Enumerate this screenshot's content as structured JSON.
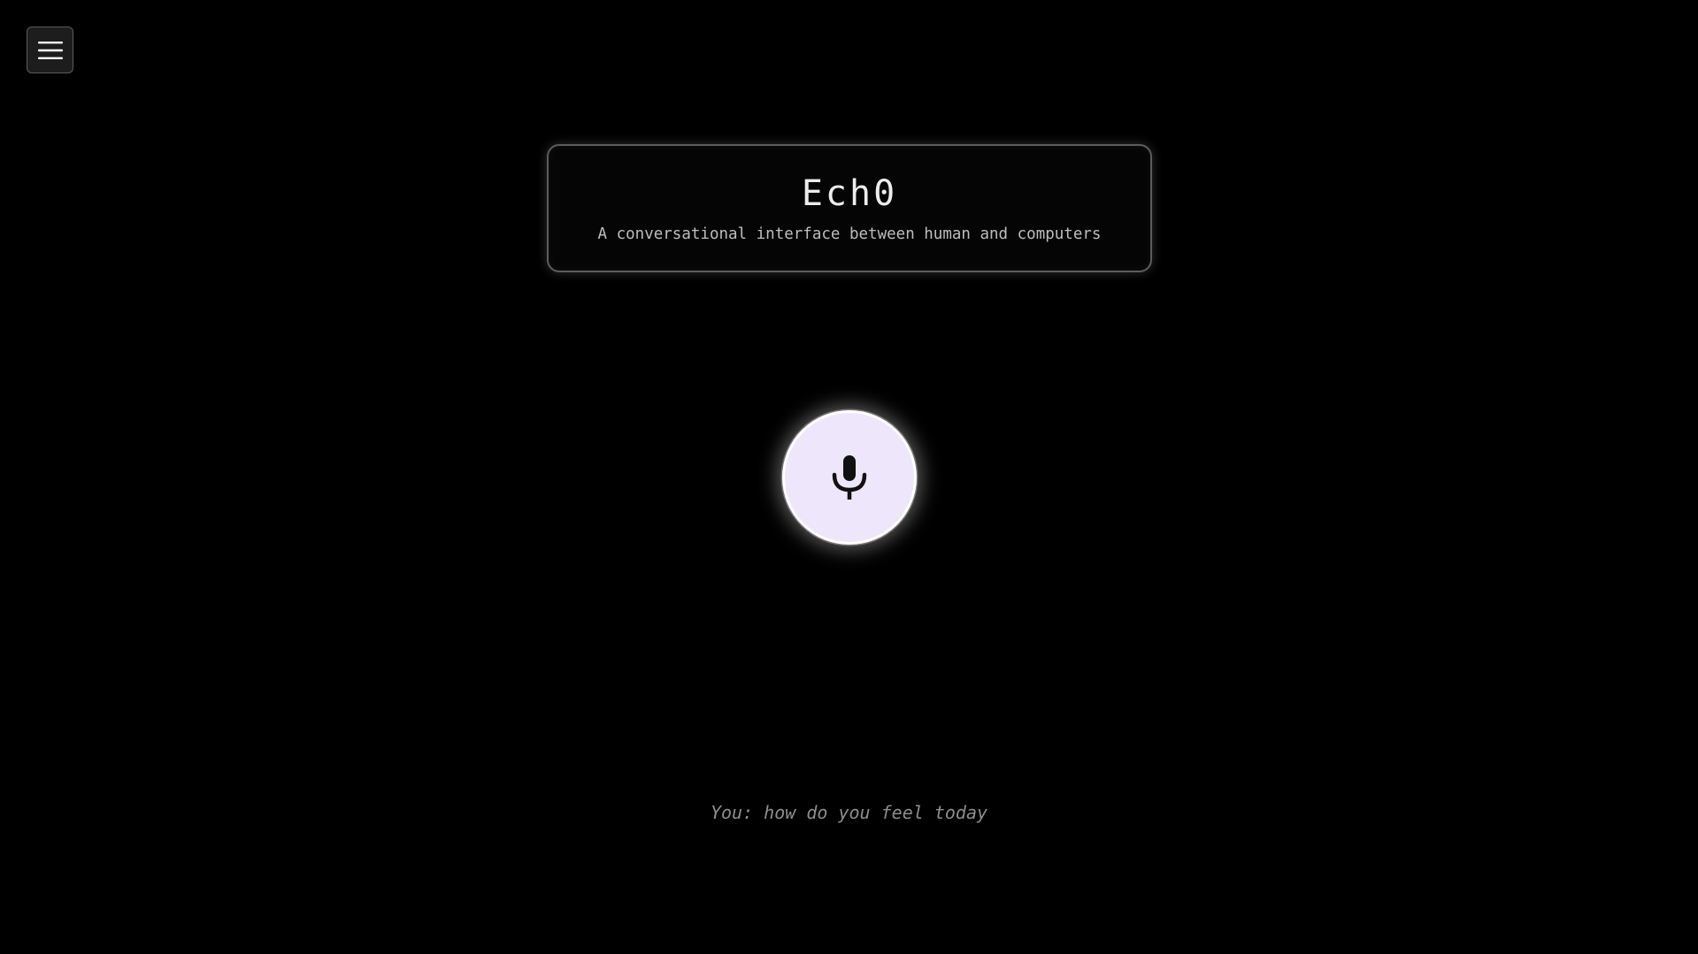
{
  "menu": {
    "icon": "hamburger-menu-icon"
  },
  "header": {
    "title": "Ech0",
    "subtitle": "A conversational interface between human and computers"
  },
  "mic": {
    "icon": "microphone-icon"
  },
  "transcript": {
    "text": "You: how do you feel today"
  },
  "colors": {
    "background": "#000000",
    "mic_fill": "#eee6fb",
    "card_border": "#5c5c5c",
    "transcript_text": "#8d8d8d"
  }
}
